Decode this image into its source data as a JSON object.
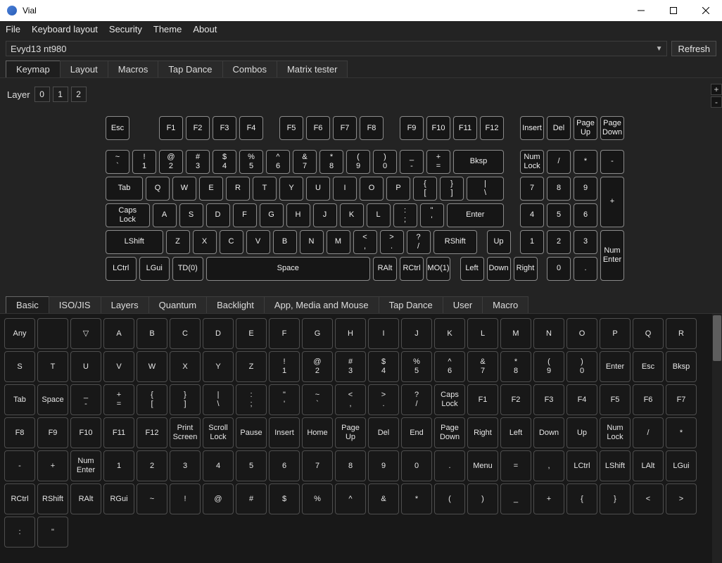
{
  "window": {
    "title": "Vial"
  },
  "menus": [
    "File",
    "Keyboard layout",
    "Security",
    "Theme",
    "About"
  ],
  "device": {
    "selected": "Evyd13 nt980"
  },
  "refresh_label": "Refresh",
  "main_tabs": [
    "Keymap",
    "Layout",
    "Macros",
    "Tap Dance",
    "Combos",
    "Matrix tester"
  ],
  "main_tab_active": 0,
  "layer_label": "Layer",
  "layer_buttons": [
    "0",
    "1",
    "2"
  ],
  "keyboard_rows": [
    {
      "y": 0,
      "keys": [
        {
          "x": 0,
          "w": 1,
          "l": "Esc"
        },
        {
          "x": 2,
          "w": 1,
          "l": "F1"
        },
        {
          "x": 3,
          "w": 1,
          "l": "F2"
        },
        {
          "x": 4,
          "w": 1,
          "l": "F3"
        },
        {
          "x": 5,
          "w": 1,
          "l": "F4"
        },
        {
          "x": 6.5,
          "w": 1,
          "l": "F5"
        },
        {
          "x": 7.5,
          "w": 1,
          "l": "F6"
        },
        {
          "x": 8.5,
          "w": 1,
          "l": "F7"
        },
        {
          "x": 9.5,
          "w": 1,
          "l": "F8"
        },
        {
          "x": 11,
          "w": 1,
          "l": "F9"
        },
        {
          "x": 12,
          "w": 1,
          "l": "F10"
        },
        {
          "x": 13,
          "w": 1,
          "l": "F11"
        },
        {
          "x": 14,
          "w": 1,
          "l": "F12"
        },
        {
          "x": 15.5,
          "w": 1,
          "l": "Insert"
        },
        {
          "x": 16.5,
          "w": 1,
          "l": "Del"
        },
        {
          "x": 17.5,
          "w": 1,
          "l": "Page\nUp"
        },
        {
          "x": 18.5,
          "w": 1,
          "l": "Page\nDown"
        }
      ]
    },
    {
      "y": 1.25,
      "keys": [
        {
          "x": 0,
          "w": 1,
          "l": "~\n`"
        },
        {
          "x": 1,
          "w": 1,
          "l": "!\n1"
        },
        {
          "x": 2,
          "w": 1,
          "l": "@\n2"
        },
        {
          "x": 3,
          "w": 1,
          "l": "#\n3"
        },
        {
          "x": 4,
          "w": 1,
          "l": "$\n4"
        },
        {
          "x": 5,
          "w": 1,
          "l": "%\n5"
        },
        {
          "x": 6,
          "w": 1,
          "l": "^\n6"
        },
        {
          "x": 7,
          "w": 1,
          "l": "&\n7"
        },
        {
          "x": 8,
          "w": 1,
          "l": "*\n8"
        },
        {
          "x": 9,
          "w": 1,
          "l": "(\n9"
        },
        {
          "x": 10,
          "w": 1,
          "l": ")\n0"
        },
        {
          "x": 11,
          "w": 1,
          "l": "_\n-"
        },
        {
          "x": 12,
          "w": 1,
          "l": "+\n="
        },
        {
          "x": 13,
          "w": 2,
          "l": "Bksp"
        },
        {
          "x": 15.5,
          "w": 1,
          "l": "Num\nLock"
        },
        {
          "x": 16.5,
          "w": 1,
          "l": "/"
        },
        {
          "x": 17.5,
          "w": 1,
          "l": "*"
        },
        {
          "x": 18.5,
          "w": 1,
          "l": "-"
        }
      ]
    },
    {
      "y": 2.25,
      "keys": [
        {
          "x": 0,
          "w": 1.5,
          "l": "Tab"
        },
        {
          "x": 1.5,
          "w": 1,
          "l": "Q"
        },
        {
          "x": 2.5,
          "w": 1,
          "l": "W"
        },
        {
          "x": 3.5,
          "w": 1,
          "l": "E"
        },
        {
          "x": 4.5,
          "w": 1,
          "l": "R"
        },
        {
          "x": 5.5,
          "w": 1,
          "l": "T"
        },
        {
          "x": 6.5,
          "w": 1,
          "l": "Y"
        },
        {
          "x": 7.5,
          "w": 1,
          "l": "U"
        },
        {
          "x": 8.5,
          "w": 1,
          "l": "I"
        },
        {
          "x": 9.5,
          "w": 1,
          "l": "O"
        },
        {
          "x": 10.5,
          "w": 1,
          "l": "P"
        },
        {
          "x": 11.5,
          "w": 1,
          "l": "{\n["
        },
        {
          "x": 12.5,
          "w": 1,
          "l": "}\n]"
        },
        {
          "x": 13.5,
          "w": 1.5,
          "l": "|\n\\"
        },
        {
          "x": 15.5,
          "w": 1,
          "l": "7"
        },
        {
          "x": 16.5,
          "w": 1,
          "l": "8"
        },
        {
          "x": 17.5,
          "w": 1,
          "l": "9"
        },
        {
          "x": 18.5,
          "w": 1,
          "h": 2,
          "l": "+"
        }
      ]
    },
    {
      "y": 3.25,
      "keys": [
        {
          "x": 0,
          "w": 1.75,
          "l": "Caps\nLock"
        },
        {
          "x": 1.75,
          "w": 1,
          "l": "A"
        },
        {
          "x": 2.75,
          "w": 1,
          "l": "S"
        },
        {
          "x": 3.75,
          "w": 1,
          "l": "D"
        },
        {
          "x": 4.75,
          "w": 1,
          "l": "F"
        },
        {
          "x": 5.75,
          "w": 1,
          "l": "G"
        },
        {
          "x": 6.75,
          "w": 1,
          "l": "H"
        },
        {
          "x": 7.75,
          "w": 1,
          "l": "J"
        },
        {
          "x": 8.75,
          "w": 1,
          "l": "K"
        },
        {
          "x": 9.75,
          "w": 1,
          "l": "L"
        },
        {
          "x": 10.75,
          "w": 1,
          "l": ":\n;"
        },
        {
          "x": 11.75,
          "w": 1,
          "l": "\"\n'"
        },
        {
          "x": 12.75,
          "w": 2.25,
          "l": "Enter"
        },
        {
          "x": 15.5,
          "w": 1,
          "l": "4"
        },
        {
          "x": 16.5,
          "w": 1,
          "l": "5"
        },
        {
          "x": 17.5,
          "w": 1,
          "l": "6"
        }
      ]
    },
    {
      "y": 4.25,
      "keys": [
        {
          "x": 0,
          "w": 2.25,
          "l": "LShift"
        },
        {
          "x": 2.25,
          "w": 1,
          "l": "Z"
        },
        {
          "x": 3.25,
          "w": 1,
          "l": "X"
        },
        {
          "x": 4.25,
          "w": 1,
          "l": "C"
        },
        {
          "x": 5.25,
          "w": 1,
          "l": "V"
        },
        {
          "x": 6.25,
          "w": 1,
          "l": "B"
        },
        {
          "x": 7.25,
          "w": 1,
          "l": "N"
        },
        {
          "x": 8.25,
          "w": 1,
          "l": "M"
        },
        {
          "x": 9.25,
          "w": 1,
          "l": "<\n,"
        },
        {
          "x": 10.25,
          "w": 1,
          "l": ">\n."
        },
        {
          "x": 11.25,
          "w": 1,
          "l": "?\n/"
        },
        {
          "x": 12.25,
          "w": 1.75,
          "l": "RShift"
        },
        {
          "x": 14.25,
          "w": 1,
          "l": "Up"
        },
        {
          "x": 15.5,
          "w": 1,
          "l": "1"
        },
        {
          "x": 16.5,
          "w": 1,
          "l": "2"
        },
        {
          "x": 17.5,
          "w": 1,
          "l": "3"
        },
        {
          "x": 18.5,
          "w": 1,
          "h": 2,
          "l": "Num\nEnter"
        }
      ]
    },
    {
      "y": 5.25,
      "keys": [
        {
          "x": 0,
          "w": 1.25,
          "l": "LCtrl"
        },
        {
          "x": 1.25,
          "w": 1.25,
          "l": "LGui"
        },
        {
          "x": 2.5,
          "w": 1.25,
          "l": "TD(0)"
        },
        {
          "x": 3.75,
          "w": 6.25,
          "l": "Space"
        },
        {
          "x": 10,
          "w": 1,
          "l": "RAlt"
        },
        {
          "x": 11,
          "w": 1,
          "l": "RCtrl"
        },
        {
          "x": 12,
          "w": 1,
          "l": "MO(1)"
        },
        {
          "x": 13.25,
          "w": 1,
          "l": "Left"
        },
        {
          "x": 14.25,
          "w": 1,
          "l": "Down"
        },
        {
          "x": 15.25,
          "w": 1,
          "l": "Right"
        },
        {
          "x": 16.5,
          "w": 1,
          "l": "0"
        },
        {
          "x": 17.5,
          "w": 1,
          "l": "."
        }
      ]
    }
  ],
  "palette_tabs": [
    "Basic",
    "ISO/JIS",
    "Layers",
    "Quantum",
    "Backlight",
    "App, Media and Mouse",
    "Tap Dance",
    "User",
    "Macro"
  ],
  "palette_tab_active": 0,
  "palette_keys": [
    "Any",
    "",
    "▽",
    "A",
    "B",
    "C",
    "D",
    "E",
    "F",
    "G",
    "H",
    "I",
    "J",
    "K",
    "L",
    "M",
    "N",
    "O",
    "P",
    "Q",
    "R",
    "S",
    "T",
    "U",
    "V",
    "W",
    "X",
    "Y",
    "Z",
    "!\n1",
    "@\n2",
    "#\n3",
    "$\n4",
    "%\n5",
    "^\n6",
    "&\n7",
    "*\n8",
    "(\n9",
    ")\n0",
    "Enter",
    "Esc",
    "Bksp",
    "Tab",
    "Space",
    "_\n-",
    "+\n=",
    "{\n[",
    "}\n]",
    "|\n\\",
    ":\n;",
    "\"\n'",
    "~\n`",
    "<\n,",
    ">\n.",
    "?\n/",
    "Caps\nLock",
    "F1",
    "F2",
    "F3",
    "F4",
    "F5",
    "F6",
    "F7",
    "F8",
    "F9",
    "F10",
    "F11",
    "F12",
    "Print\nScreen",
    "Scroll\nLock",
    "Pause",
    "Insert",
    "Home",
    "Page\nUp",
    "Del",
    "End",
    "Page\nDown",
    "Right",
    "Left",
    "Down",
    "Up",
    "Num\nLock",
    "/",
    "*",
    "-",
    "+",
    "Num\nEnter",
    "1",
    "2",
    "3",
    "4",
    "5",
    "6",
    "7",
    "8",
    "9",
    "0",
    ".",
    "Menu",
    "=",
    ",",
    "LCtrl",
    "LShift",
    "LAlt",
    "LGui",
    "RCtrl",
    "RShift",
    "RAlt",
    "RGui",
    "~",
    "!",
    "@",
    "#",
    "$",
    "%",
    "^",
    "&",
    "*",
    "(",
    ")",
    "_",
    "+",
    "{",
    "}",
    "<",
    ">",
    ":",
    "\""
  ]
}
